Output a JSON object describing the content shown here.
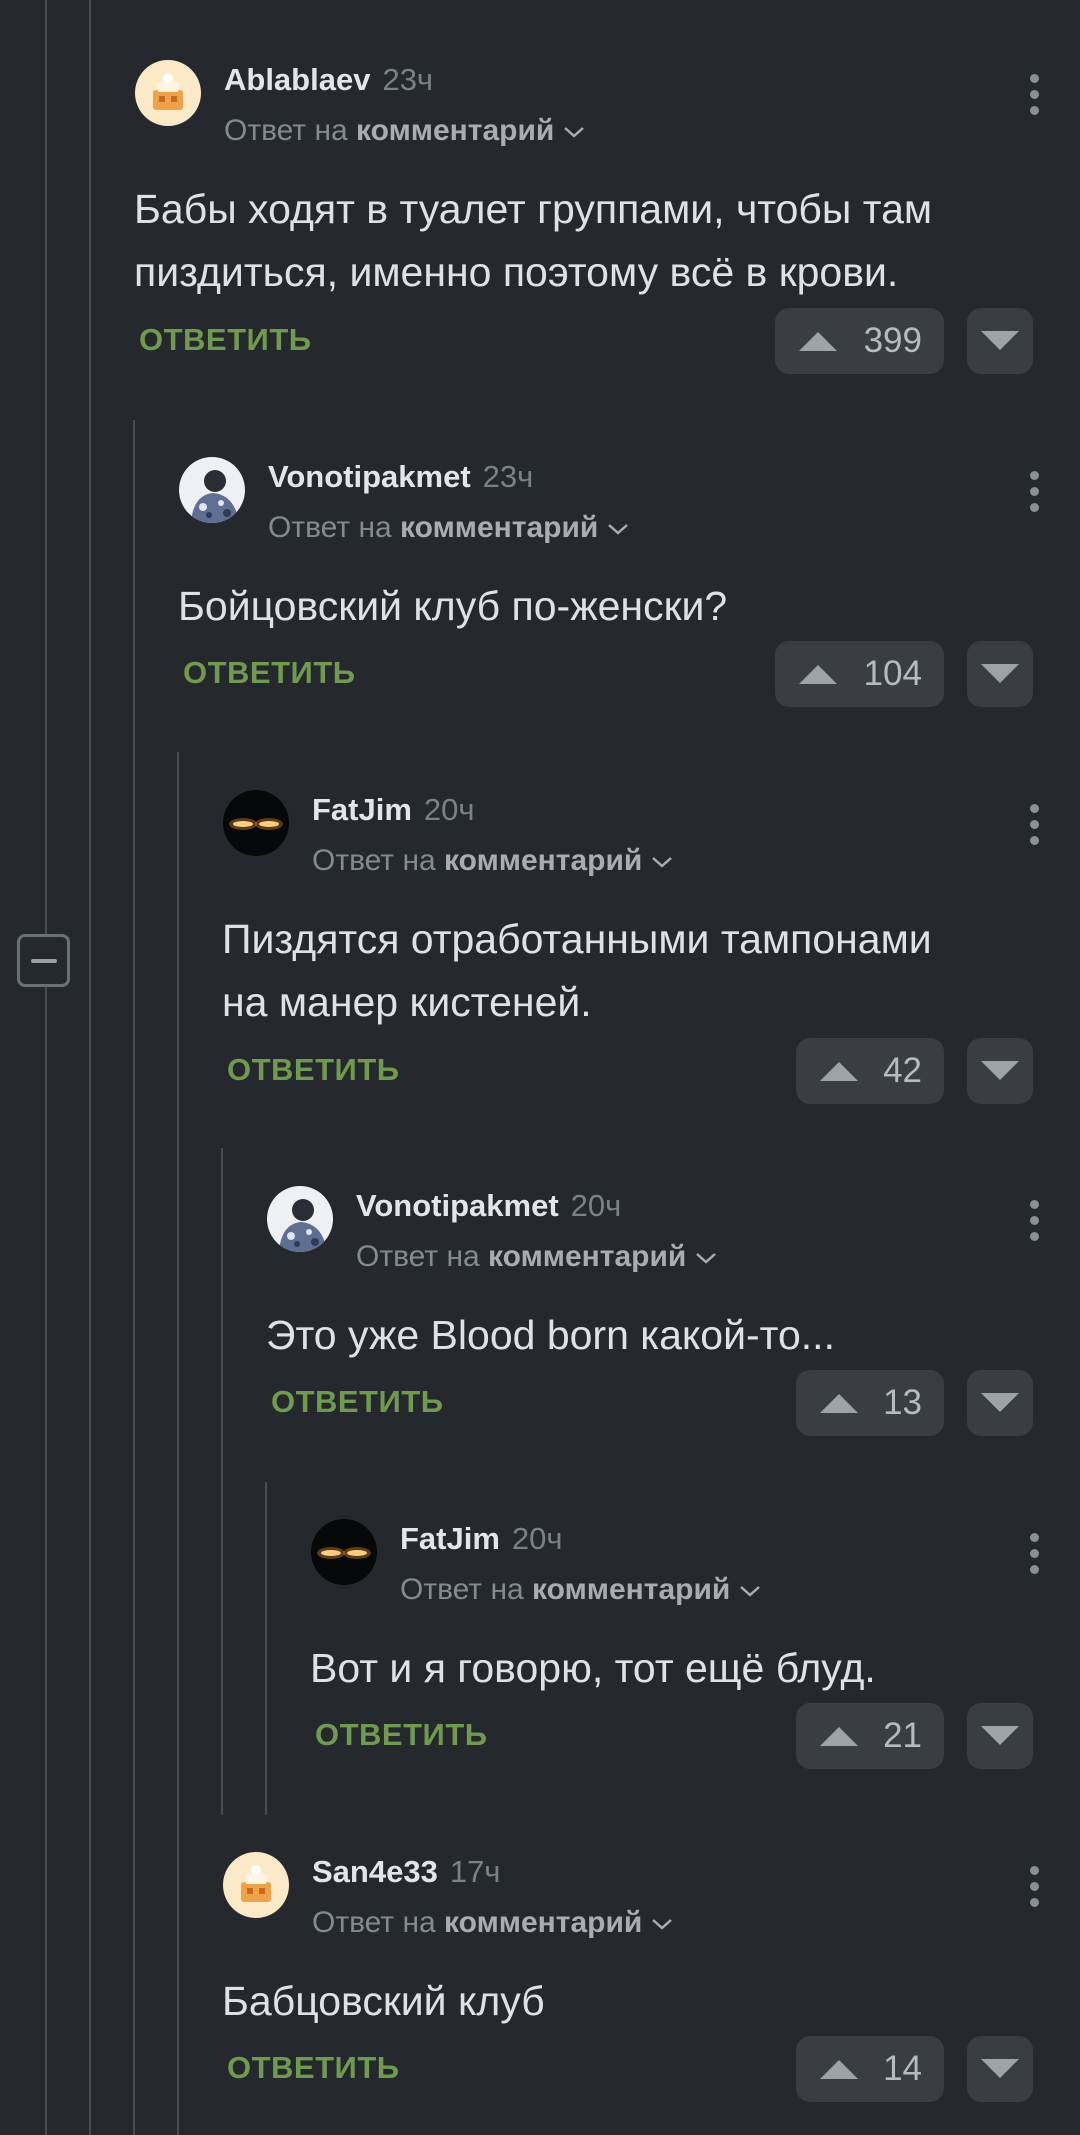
{
  "labels": {
    "reply_prefix": "Ответ на",
    "reply_target": "комментарий",
    "reply_button": "ОТВЕТИТЬ"
  },
  "colors": {
    "background": "#25282c",
    "reply_green": "#6f9a4f",
    "vote_bg": "#3a3e43"
  },
  "comments": [
    {
      "author": "Ablablaev",
      "time": "23ч",
      "avatar": "cake-avatar",
      "text_lines": [
        "Бабы ходят в туалет группами, чтобы там",
        "пиздиться, именно поэтому всё в крови."
      ],
      "votes": "399"
    },
    {
      "author": "Vonotipakmet",
      "time": "23ч",
      "avatar": "camo-person-avatar",
      "text_lines": [
        "Бойцовский клуб по-женски?"
      ],
      "votes": "104"
    },
    {
      "author": "FatJim",
      "time": "20ч",
      "avatar": "glowing-eyes-avatar",
      "text_lines": [
        "Пиздятся отработанными тампонами",
        "на манер кистеней."
      ],
      "votes": "42"
    },
    {
      "author": "Vonotipakmet",
      "time": "20ч",
      "avatar": "camo-person-avatar",
      "text_lines": [
        "Это уже Blood born какой-то..."
      ],
      "votes": "13"
    },
    {
      "author": "FatJim",
      "time": "20ч",
      "avatar": "glowing-eyes-avatar",
      "text_lines": [
        "Вот и я говорю, тот ещё блуд."
      ],
      "votes": "21"
    },
    {
      "author": "San4e33",
      "time": "17ч",
      "avatar": "cake-avatar",
      "text_lines": [
        "Бабцовский клуб"
      ],
      "votes": "14"
    }
  ]
}
